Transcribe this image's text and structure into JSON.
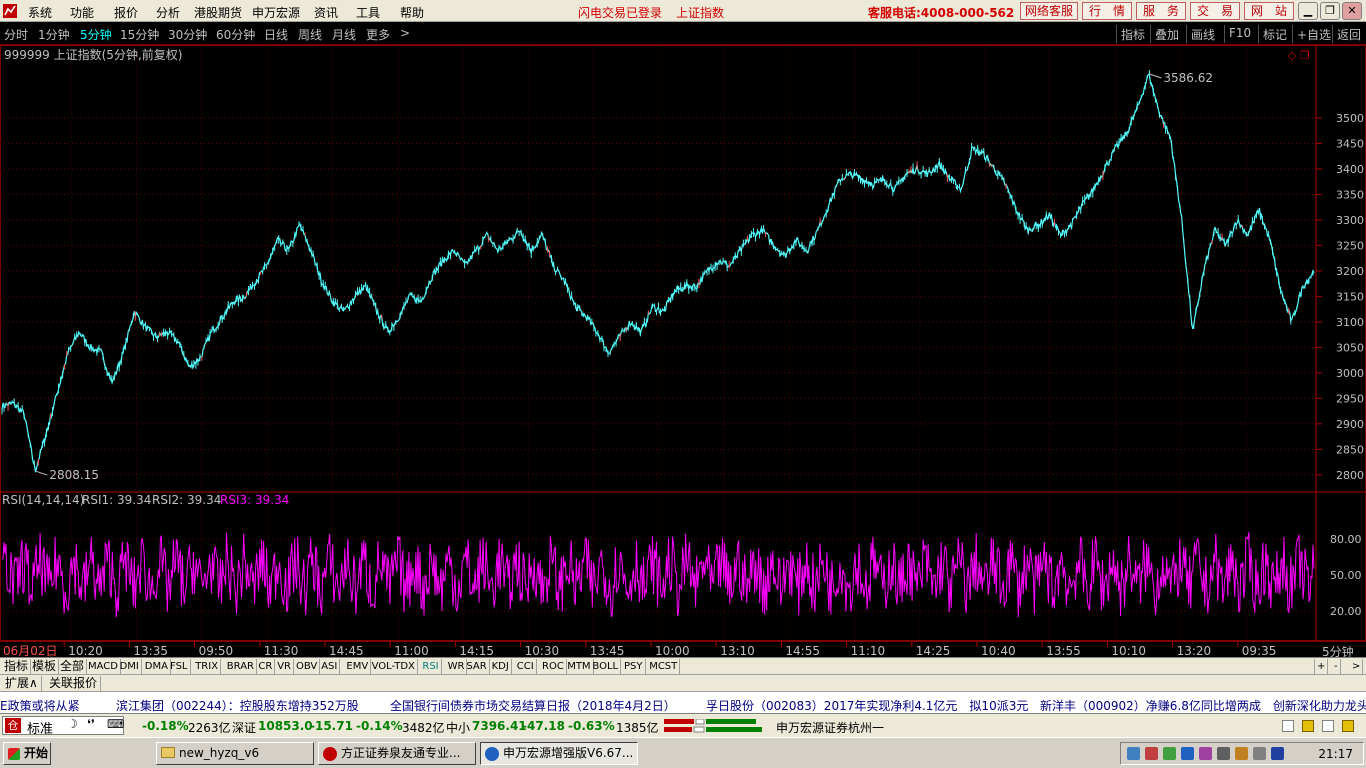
{
  "menubar": {
    "items": [
      "系统",
      "功能",
      "报价",
      "分析",
      "港股期货",
      "申万宏源",
      "资讯",
      "工具",
      "帮助"
    ],
    "status_login": "闪电交易已登录",
    "status_index": "上证指数",
    "phone": "客服电话:4008-000-562",
    "buttons": [
      "网络客服",
      "行　情",
      "服　务",
      "交　易",
      "网　站"
    ]
  },
  "periodbar": {
    "periods": [
      "分时",
      "1分钟",
      "5分钟",
      "15分钟",
      "30分钟",
      "60分钟",
      "日线",
      "周线",
      "月线",
      "更多"
    ],
    "active": "5分钟",
    "more_arrow": ">",
    "tools": [
      "指标",
      "叠加",
      "画线",
      "F10",
      "标记",
      "+自选",
      "返回"
    ]
  },
  "chart_title": "999999 上证指数(5分钟,前复权)",
  "chart_data": {
    "type": "line",
    "main": {
      "ylim": [
        2780,
        3600
      ],
      "yticks": [
        2800,
        2850,
        2900,
        2950,
        3000,
        3050,
        3100,
        3150,
        3200,
        3250,
        3300,
        3350,
        3400,
        3450,
        3500
      ],
      "high_label": "3586.62",
      "low_label": "2808.15",
      "keypoints": [
        2935,
        2940,
        2920,
        2808,
        2880,
        2960,
        3040,
        3080,
        3050,
        3040,
        2980,
        3040,
        3120,
        3090,
        3070,
        3080,
        3060,
        3010,
        3030,
        3080,
        3110,
        3140,
        3150,
        3180,
        3210,
        3260,
        3240,
        3290,
        3240,
        3180,
        3140,
        3120,
        3150,
        3170,
        3120,
        3080,
        3110,
        3150,
        3140,
        3190,
        3220,
        3240,
        3210,
        3240,
        3270,
        3240,
        3260,
        3280,
        3240,
        3270,
        3210,
        3180,
        3130,
        3110,
        3080,
        3040,
        3070,
        3100,
        3080,
        3130,
        3120,
        3160,
        3170,
        3170,
        3200,
        3220,
        3210,
        3240,
        3270,
        3280,
        3250,
        3230,
        3260,
        3240,
        3280,
        3330,
        3380,
        3390,
        3380,
        3370,
        3380,
        3360,
        3390,
        3400,
        3390,
        3410,
        3380,
        3360,
        3440,
        3430,
        3400,
        3370,
        3320,
        3280,
        3290,
        3310,
        3270,
        3290,
        3330,
        3360,
        3400,
        3440,
        3470,
        3520,
        3586,
        3510,
        3460,
        3300,
        3080,
        3200,
        3280,
        3250,
        3300,
        3270,
        3320,
        3260,
        3160,
        3100,
        3170,
        3200
      ]
    },
    "rsi": {
      "label": "RSI(14,14,14)",
      "rsi1_label": "RSI1: 39.34",
      "rsi2_label": "RSI2: 39.34",
      "rsi3_label": "RSI3: 39.34",
      "ylim": [
        0,
        100
      ],
      "yticks": [
        20,
        50,
        80
      ],
      "ytick_labels": [
        "20.00",
        "50.00",
        "80.00"
      ]
    },
    "x_labels": [
      "06月02日",
      "10:20",
      "13:35",
      "09:50",
      "11:30",
      "14:45",
      "11:00",
      "14:15",
      "10:30",
      "13:45",
      "10:00",
      "13:10",
      "14:55",
      "11:10",
      "14:25",
      "10:40",
      "13:55",
      "10:10",
      "13:20",
      "09:35"
    ],
    "period_label": "5分钟"
  },
  "indicator_tabs": [
    "指标",
    "模板",
    "全部",
    "MACD",
    "DMI",
    "DMA",
    "FSL",
    "TRIX",
    "BRAR",
    "CR",
    "VR",
    "OBV",
    "ASI",
    "EMV",
    "VOL-TDX",
    "RSI",
    "WR",
    "SAR",
    "KDJ",
    "CCI",
    "ROC",
    "MTM",
    "BOLL",
    "PSY",
    "MCST"
  ],
  "active_indicator": "RSI",
  "indicator_controls": [
    "+",
    "-",
    ">"
  ],
  "sub_tabs": [
    "扩展∧",
    "关联报价"
  ],
  "ticker": [
    "E政策或将从紧",
    "滨江集团（002244）：控股股东增持352万股",
    "全国银行间债券市场交易结算日报（2018年4月2日）",
    "孚日股份（002083）2017年实现净利4.1亿元　拟10派3元",
    "新洋丰（000902）净赚6.8亿同比增两成　创新深化助力龙头加"
  ],
  "statusbar": {
    "mode": "标准",
    "sh_pct": "-0.18%",
    "sh_amt": "2263亿",
    "sz_name": "深证",
    "sz_val": "10853.0",
    "sz_chg": "-15.71",
    "sz_pct": "-0.14%",
    "sz_amt": "3482亿",
    "zx_name": "中小",
    "zx_val": "7396.41",
    "zx_chg": "-47.18",
    "zx_pct": "-0.63%",
    "zx_amt": "1385亿",
    "broker": "申万宏源证券杭州一"
  },
  "taskbar": {
    "start": "开始",
    "tasks": [
      "new_hyzq_v6",
      "方正证券泉友通专业...",
      "申万宏源增强版V6.67..."
    ],
    "clock": "21:17"
  }
}
